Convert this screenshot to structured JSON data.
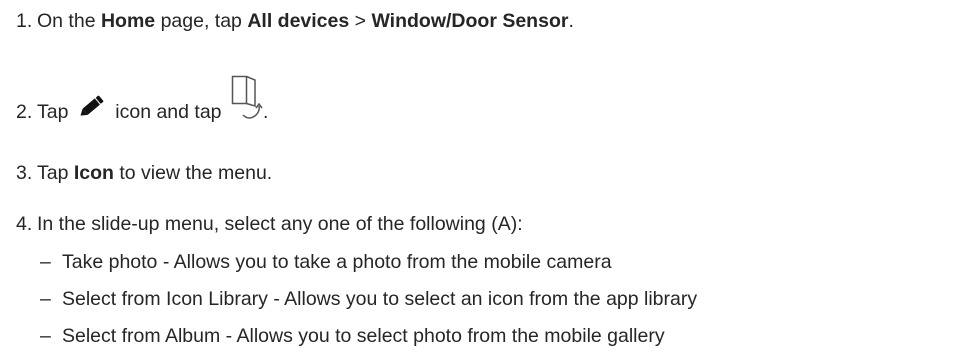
{
  "steps": [
    {
      "number": "1.",
      "parts": [
        "On the ",
        "Home",
        " page, tap ",
        "All devices",
        " > ",
        "Window/Door Sensor",
        "."
      ]
    },
    {
      "number": "2.",
      "text_before_pencil": "Tap ",
      "pencil_icon": "pencil-edit-icon",
      "text_between": " icon and tap ",
      "rotate_icon": "door-rotate-icon",
      "text_after": "."
    },
    {
      "number": "3.",
      "parts": [
        "Tap ",
        "Icon",
        " to view the menu."
      ]
    },
    {
      "number": "4.",
      "text": "In the slide-up menu, select any one of the following (A):",
      "options": [
        "Take photo - Allows you to take a photo from the mobile camera",
        "Select from Icon Library - Allows you to select an icon from the app library",
        "Select from Album - Allows you to select photo from the mobile gallery"
      ]
    }
  ],
  "dash": "–",
  "colors": {
    "text": "#262626",
    "icon": "#111111",
    "icon_outline": "#555555"
  }
}
